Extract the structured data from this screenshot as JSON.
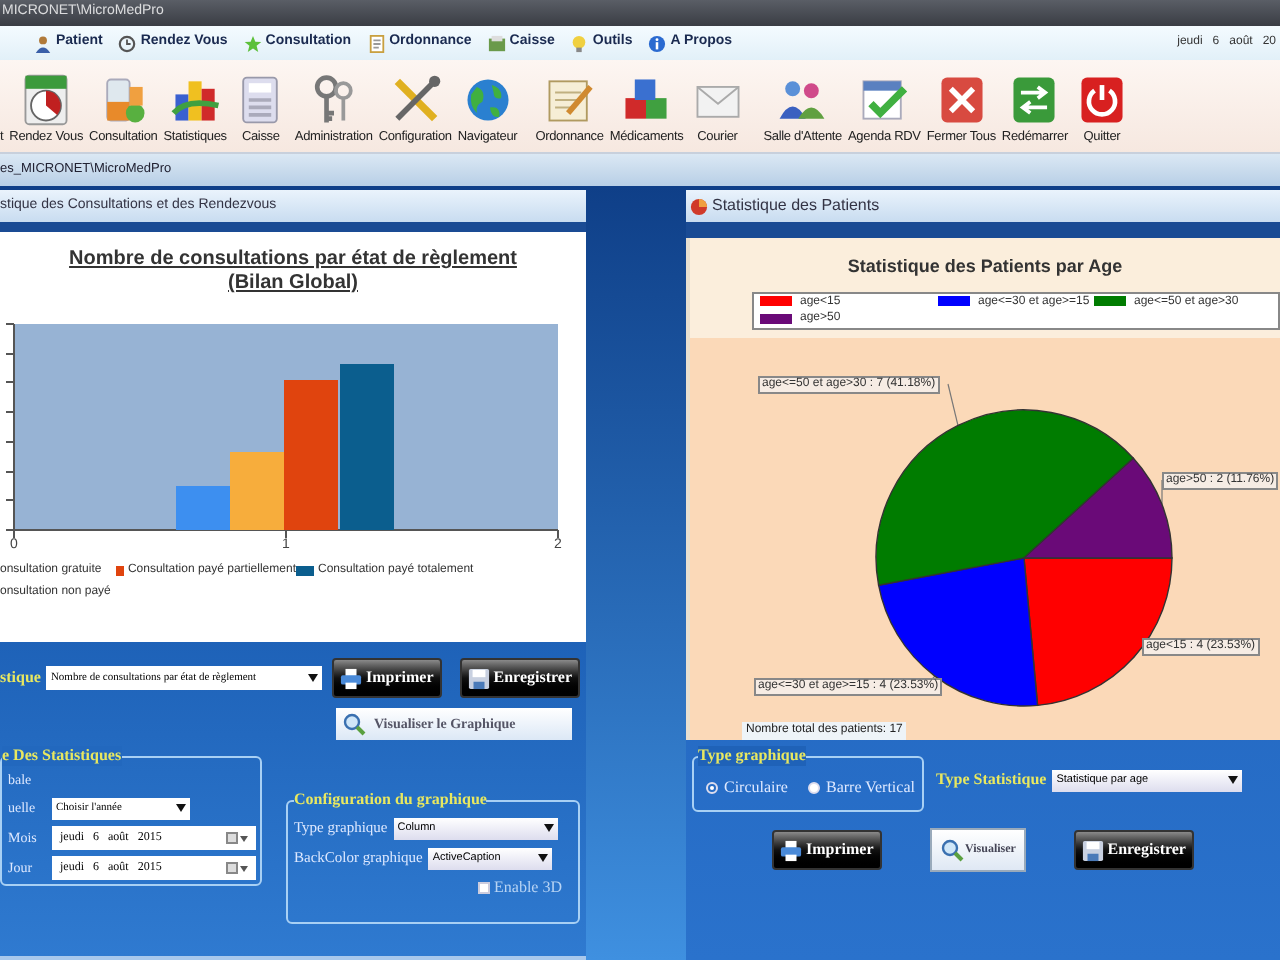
{
  "window": {
    "title": "MICRONET\\MicroMedPro"
  },
  "menu": [
    {
      "label": "Patient"
    },
    {
      "label": "Rendez Vous"
    },
    {
      "label": "Consultation"
    },
    {
      "label": "Ordonnance"
    },
    {
      "label": "Caisse"
    },
    {
      "label": "Outils"
    },
    {
      "label": "A Propos"
    }
  ],
  "date": "jeudi   6   août   20",
  "toolbar": [
    "t",
    "Rendez Vous",
    "Consultation",
    "Statistiques",
    "Caisse",
    "Administration",
    "Configuration",
    "Navigateur",
    "Ordonnance",
    "Médicaments",
    "Courier",
    "Salle d'Attente",
    "Agenda RDV",
    "Fermer Tous",
    "Redémarrer",
    "Quitter"
  ],
  "document_title": "es_MICRONET\\MicroMedPro",
  "left_panel": {
    "title": "stique des Consultations et des Rendezvous",
    "chart": {
      "title": "Nombre de consultations par état de règlement",
      "subtitle": "(Bilan Global)",
      "x_ticks": [
        "0",
        "1",
        "2"
      ],
      "legend": [
        {
          "label": "onsultation gratuite"
        },
        {
          "label": "Consultation payé partiellement",
          "color": "#e0440e"
        },
        {
          "label": "Consultation payé totalement",
          "color": "#0b5e8e"
        },
        {
          "label": "onsultation non payé"
        }
      ]
    },
    "statistic_label": "stique",
    "statistic_select": "Nombre de consultations par état de règlement",
    "buttons": [
      {
        "label": "Imprimer",
        "kind": "print"
      },
      {
        "label": "Enregistrer",
        "kind": "save"
      }
    ],
    "visualize_button": "Visualiser le Graphique",
    "period_group": {
      "title": "e Des Statistiques",
      "rows": [
        {
          "kind": "label",
          "label": "bale"
        },
        {
          "kind": "select",
          "label": "uelle",
          "value": "Choisir l'année"
        },
        {
          "kind": "date",
          "label": "Mois",
          "value": "jeudi   6   août   2015"
        },
        {
          "kind": "date",
          "label": "Jour",
          "value": "jeudi   6   août   2015"
        }
      ]
    },
    "config_group": {
      "title": "Configuration du graphique",
      "fields": [
        {
          "label": "Type graphique",
          "value": "Column"
        },
        {
          "label": "BackColor graphique",
          "value": "ActiveCaption"
        }
      ],
      "enable_3d": {
        "label": "Enable 3D",
        "checked": false
      }
    }
  },
  "right_panel": {
    "title": "Statistique des Patients",
    "chart_data": {
      "type": "pie",
      "title": "Statistique des Patients par Age",
      "categories": [
        "age<15",
        "age<=30 et age>=15",
        "age<=50 et age>30",
        "age>50"
      ],
      "values": [
        4,
        4,
        7,
        2
      ],
      "colors": [
        "#ff0000",
        "#0000ff",
        "#007c00",
        "#6a0a78"
      ],
      "legend": "top",
      "value_labels": [
        "age<15 : 4 (23.53%)",
        "age<=30 et age>=15 : 4 (23.53%)",
        "age<=50 et age>30 : 7 (41.18%)",
        "age>50 : 2 (11.76%)"
      ]
    },
    "total": "Nombre total des patients: 17",
    "chart_type_group": {
      "title": "Type graphique",
      "options": [
        {
          "label": "Circulaire",
          "selected": true
        },
        {
          "label": "Barre Vertical",
          "selected": false
        }
      ]
    },
    "statistic_label": "Type Statistique",
    "statistic_select": "Statistique par age",
    "buttons": [
      {
        "label": "Imprimer",
        "kind": "print"
      },
      {
        "label": "Visualiser",
        "kind": "view"
      },
      {
        "label": "Enregistrer",
        "kind": "save"
      }
    ]
  }
}
